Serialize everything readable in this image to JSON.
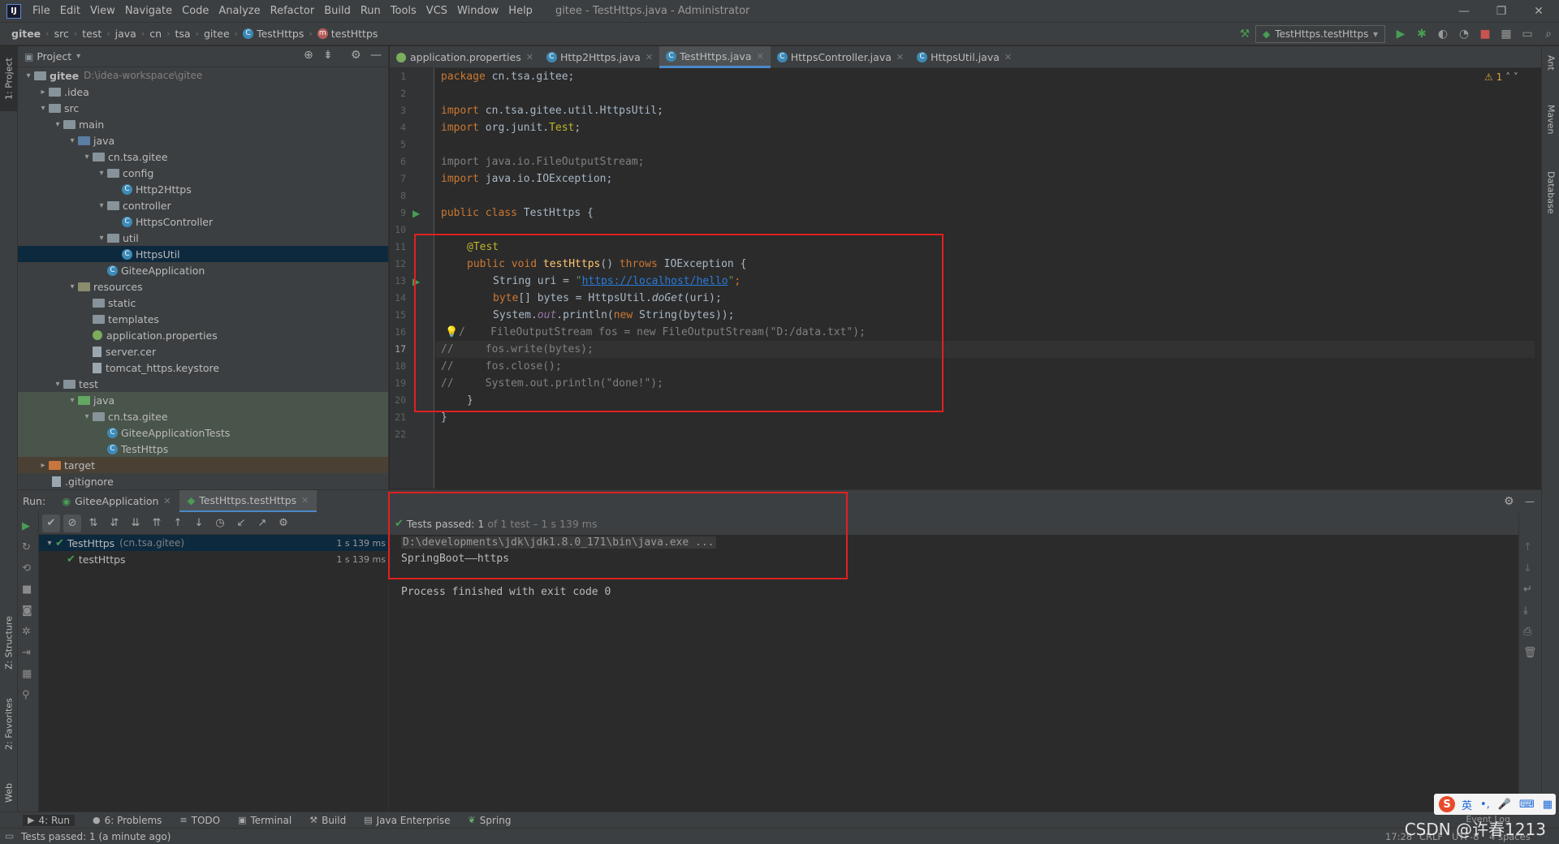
{
  "menubar": {
    "items": [
      "File",
      "Edit",
      "View",
      "Navigate",
      "Code",
      "Analyze",
      "Refactor",
      "Build",
      "Run",
      "Tools",
      "VCS",
      "Window",
      "Help"
    ],
    "window_title": "gitee - TestHttps.java - Administrator",
    "minimize": "—",
    "restore": "❐",
    "close": "✕"
  },
  "breadcrumb": [
    "gitee",
    "src",
    "test",
    "java",
    "cn",
    "tsa",
    "gitee",
    "TestHttps",
    "testHttps"
  ],
  "run_config": "TestHttps.testHttps",
  "project": {
    "title": "Project",
    "vtab": "1: Project",
    "tree": [
      {
        "label": "gitee",
        "extra": "D:\\idea-workspace\\gitee"
      },
      {
        "label": ".idea"
      },
      {
        "label": "src"
      },
      {
        "label": "main"
      },
      {
        "label": "java"
      },
      {
        "label": "cn.tsa.gitee"
      },
      {
        "label": "config"
      },
      {
        "label": "Http2Https"
      },
      {
        "label": "controller"
      },
      {
        "label": "HttpsController"
      },
      {
        "label": "util"
      },
      {
        "label": "HttpsUtil"
      },
      {
        "label": "GiteeApplication"
      },
      {
        "label": "resources"
      },
      {
        "label": "static"
      },
      {
        "label": "templates"
      },
      {
        "label": "application.properties"
      },
      {
        "label": "server.cer"
      },
      {
        "label": "tomcat_https.keystore"
      },
      {
        "label": "test"
      },
      {
        "label": "java"
      },
      {
        "label": "cn.tsa.gitee"
      },
      {
        "label": "GiteeApplicationTests"
      },
      {
        "label": "TestHttps"
      },
      {
        "label": "target"
      },
      {
        "label": ".gitignore"
      }
    ]
  },
  "editor_tabs": [
    {
      "label": "application.properties"
    },
    {
      "label": "Http2Https.java"
    },
    {
      "label": "TestHttps.java"
    },
    {
      "label": "HttpsController.java"
    },
    {
      "label": "HttpsUtil.java"
    }
  ],
  "editor": {
    "warning_count": "1",
    "current_line": 17,
    "line_numbers": [
      "1",
      "2",
      "3",
      "4",
      "5",
      "6",
      "7",
      "8",
      "9",
      "10",
      "11",
      "12",
      "13",
      "14",
      "15",
      "16",
      "17",
      "18",
      "19",
      "20",
      "21",
      "22"
    ]
  },
  "code": {
    "l1": [
      "package",
      " cn.tsa.gitee;"
    ],
    "l3": [
      "import",
      " cn.tsa.gitee.util.HttpsUtil;"
    ],
    "l4": [
      "import",
      " org.junit.",
      "Test",
      ";"
    ],
    "l6": "import java.io.FileOutputStream;",
    "l7": [
      "import",
      " java.io.IOException;"
    ],
    "l9": [
      "public class",
      " TestHttps {"
    ],
    "l11": "@Test",
    "l12": [
      "public void ",
      "testHttps",
      "() ",
      "throws",
      " IOException {"
    ],
    "l13": [
      "String uri = ",
      "\"",
      "https://localhost/hello",
      "\"",
      ";"
    ],
    "l14": [
      "byte",
      "[] bytes = HttpsUtil.",
      "doGet",
      "(uri);"
    ],
    "l15": [
      "System.",
      "out",
      ".println(",
      "new",
      " String(bytes));"
    ],
    "l16": "/    FileOutputStream fos = new FileOutputStream(\"D:/data.txt\");",
    "l17": "//     fos.write(bytes);",
    "l18": "//     fos.close();",
    "l19": "//     System.out.println(\"done!\");",
    "l20": "}",
    "l21": "}"
  },
  "right_strip": [
    "Ant",
    "Maven",
    "Database"
  ],
  "run_panel": {
    "label": "Run:",
    "tabs": [
      "GiteeApplication",
      "TestHttps.testHttps"
    ],
    "status": "Tests passed: 1",
    "status_detail": "of 1 test – 1 s 139 ms",
    "tree": [
      {
        "label": "TestHttps",
        "extra": "(cn.tsa.gitee)",
        "time": "1 s 139 ms"
      },
      {
        "label": "testHttps",
        "time": "1 s 139 ms"
      }
    ],
    "console": [
      "D:\\developments\\jdk\\jdk1.8.0_171\\bin\\java.exe ...",
      "SpringBoot——https",
      "",
      "Process finished with exit code 0"
    ]
  },
  "left_vtabs": {
    "structure": "Z: Structure",
    "favorites": "2: Favorites",
    "web": "Web"
  },
  "bottom_bar": [
    {
      "label": "4: Run",
      "icon": "run-icon"
    },
    {
      "label": "6: Problems",
      "icon": "problems-icon"
    },
    {
      "label": "TODO",
      "icon": "todo-icon"
    },
    {
      "label": "Terminal",
      "icon": "terminal-icon"
    },
    {
      "label": "Build",
      "icon": "build-icon"
    },
    {
      "label": "Java Enterprise",
      "icon": "java-enterprise-icon"
    },
    {
      "label": "Spring",
      "icon": "spring-icon"
    }
  ],
  "event_log": "Event Log",
  "status_bar": {
    "text": "Tests passed: 1 (a minute ago)",
    "position": "17:28",
    "line_sep": "CRLF",
    "encoding": "UTF-8",
    "indent": "4 spaces"
  },
  "ime": {
    "logo": "S",
    "lang": "英"
  },
  "watermark": "CSDN @许春1213",
  "colors": {
    "accent": "#4a88c7",
    "highlight_box": "#e02020",
    "pass_green": "#499c54"
  }
}
